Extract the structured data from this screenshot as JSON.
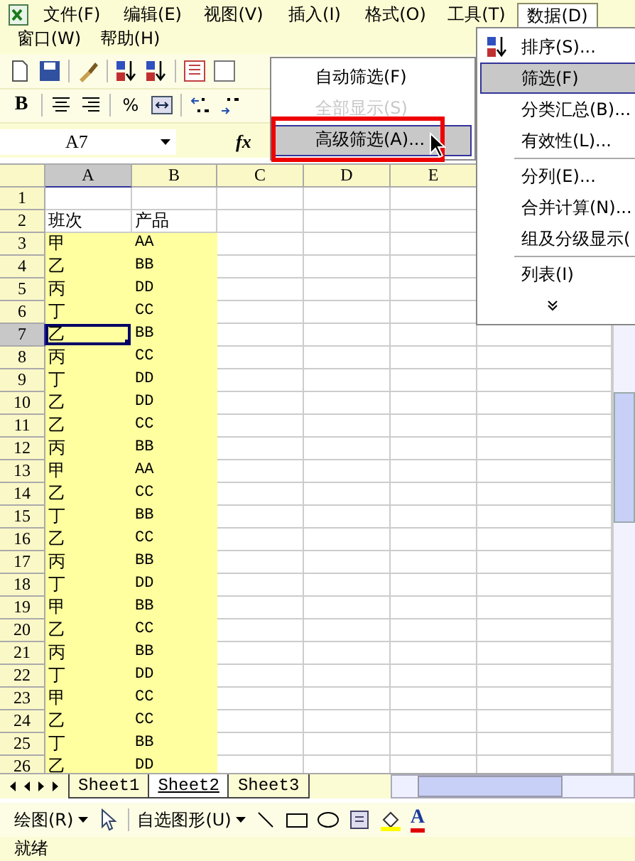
{
  "menubar": {
    "items": [
      {
        "label": "文件(F)",
        "selected": false
      },
      {
        "label": "编辑(E)",
        "selected": false
      },
      {
        "label": "视图(V)",
        "selected": false
      },
      {
        "label": "插入(I)",
        "selected": false
      },
      {
        "label": "格式(O)",
        "selected": false
      },
      {
        "label": "工具(T)",
        "selected": false
      },
      {
        "label": "数据(D)",
        "selected": true
      },
      {
        "label": "窗口(W)",
        "selected": false
      },
      {
        "label": "帮助(H)",
        "selected": false
      }
    ]
  },
  "format_toolbar": {
    "bold": "B",
    "percent": "%"
  },
  "formula_bar": {
    "name_box": "A7",
    "fx": "fx"
  },
  "sheet": {
    "columns": [
      {
        "label": "A",
        "selected": true
      },
      {
        "label": "B",
        "selected": false
      },
      {
        "label": "C",
        "selected": false
      },
      {
        "label": "D",
        "selected": false
      },
      {
        "label": "E",
        "selected": false
      }
    ],
    "rows": [
      {
        "number": "1",
        "selected": false,
        "highlighted": false,
        "cells": []
      },
      {
        "number": "2",
        "selected": false,
        "highlighted": false,
        "cells": [
          "班次",
          "产品"
        ]
      },
      {
        "number": "3",
        "selected": false,
        "highlighted": true,
        "cells": [
          "甲",
          "AA"
        ]
      },
      {
        "number": "4",
        "selected": false,
        "highlighted": true,
        "cells": [
          "乙",
          "BB"
        ]
      },
      {
        "number": "5",
        "selected": false,
        "highlighted": true,
        "cells": [
          "丙",
          "DD"
        ]
      },
      {
        "number": "6",
        "selected": false,
        "highlighted": true,
        "cells": [
          "丁",
          "CC"
        ]
      },
      {
        "number": "7",
        "selected": true,
        "highlighted": true,
        "cells": [
          "乙",
          "BB"
        ]
      },
      {
        "number": "8",
        "selected": false,
        "highlighted": true,
        "cells": [
          "丙",
          "CC"
        ]
      },
      {
        "number": "9",
        "selected": false,
        "highlighted": true,
        "cells": [
          "丁",
          "DD"
        ]
      },
      {
        "number": "10",
        "selected": false,
        "highlighted": true,
        "cells": [
          "乙",
          "DD"
        ]
      },
      {
        "number": "11",
        "selected": false,
        "highlighted": true,
        "cells": [
          "乙",
          "CC"
        ]
      },
      {
        "number": "12",
        "selected": false,
        "highlighted": true,
        "cells": [
          "丙",
          "BB"
        ]
      },
      {
        "number": "13",
        "selected": false,
        "highlighted": true,
        "cells": [
          "甲",
          "AA"
        ]
      },
      {
        "number": "14",
        "selected": false,
        "highlighted": true,
        "cells": [
          "乙",
          "CC"
        ]
      },
      {
        "number": "15",
        "selected": false,
        "highlighted": true,
        "cells": [
          "丁",
          "BB"
        ]
      },
      {
        "number": "16",
        "selected": false,
        "highlighted": true,
        "cells": [
          "乙",
          "CC"
        ]
      },
      {
        "number": "17",
        "selected": false,
        "highlighted": true,
        "cells": [
          "丙",
          "BB"
        ]
      },
      {
        "number": "18",
        "selected": false,
        "highlighted": true,
        "cells": [
          "丁",
          "DD"
        ]
      },
      {
        "number": "19",
        "selected": false,
        "highlighted": true,
        "cells": [
          "甲",
          "BB"
        ]
      },
      {
        "number": "20",
        "selected": false,
        "highlighted": true,
        "cells": [
          "乙",
          "CC"
        ]
      },
      {
        "number": "21",
        "selected": false,
        "highlighted": true,
        "cells": [
          "丙",
          "BB"
        ]
      },
      {
        "number": "22",
        "selected": false,
        "highlighted": true,
        "cells": [
          "丁",
          "DD"
        ]
      },
      {
        "number": "23",
        "selected": false,
        "highlighted": true,
        "cells": [
          "甲",
          "CC"
        ]
      },
      {
        "number": "24",
        "selected": false,
        "highlighted": true,
        "cells": [
          "乙",
          "CC"
        ]
      },
      {
        "number": "25",
        "selected": false,
        "highlighted": true,
        "cells": [
          "丁",
          "BB"
        ]
      },
      {
        "number": "26",
        "selected": false,
        "highlighted": true,
        "cells": [
          "乙",
          "DD"
        ]
      }
    ]
  },
  "filter_submenu": {
    "items": [
      {
        "label": "自动筛选(F)",
        "disabled": false,
        "selected": false
      },
      {
        "label": "全部显示(S)",
        "disabled": true,
        "selected": false
      },
      {
        "label": "高级筛选(A)...",
        "disabled": false,
        "selected": true
      }
    ]
  },
  "data_menu": {
    "items": [
      {
        "label": "排序(S)...",
        "kind": "sort",
        "selected": false,
        "divider_before": false
      },
      {
        "label": "筛选(F)",
        "kind": "plain",
        "selected": true,
        "divider_before": false
      },
      {
        "label": "分类汇总(B)...",
        "kind": "plain",
        "selected": false,
        "divider_before": false
      },
      {
        "label": "有效性(L)...",
        "kind": "plain",
        "selected": false,
        "divider_before": false
      },
      {
        "label": "分列(E)...",
        "kind": "plain",
        "selected": false,
        "divider_before": true
      },
      {
        "label": "合并计算(N)...",
        "kind": "plain",
        "selected": false,
        "divider_before": false
      },
      {
        "label": "组及分级显示(",
        "kind": "plain",
        "selected": false,
        "divider_before": false
      },
      {
        "label": "列表(I)",
        "kind": "plain",
        "selected": false,
        "divider_before": true
      },
      {
        "kind": "expand",
        "selected": false,
        "divider_before": false
      }
    ]
  },
  "sheet_tabs": [
    {
      "label": "Sheet1",
      "selected": false
    },
    {
      "label": "Sheet2",
      "selected": true
    },
    {
      "label": "Sheet3",
      "selected": false
    }
  ],
  "drawing_toolbar": {
    "draw_menu": "绘图(R)",
    "autoshapes": "自选图形(U)",
    "font_color": "A"
  },
  "status_bar": {
    "text": "就绪"
  }
}
